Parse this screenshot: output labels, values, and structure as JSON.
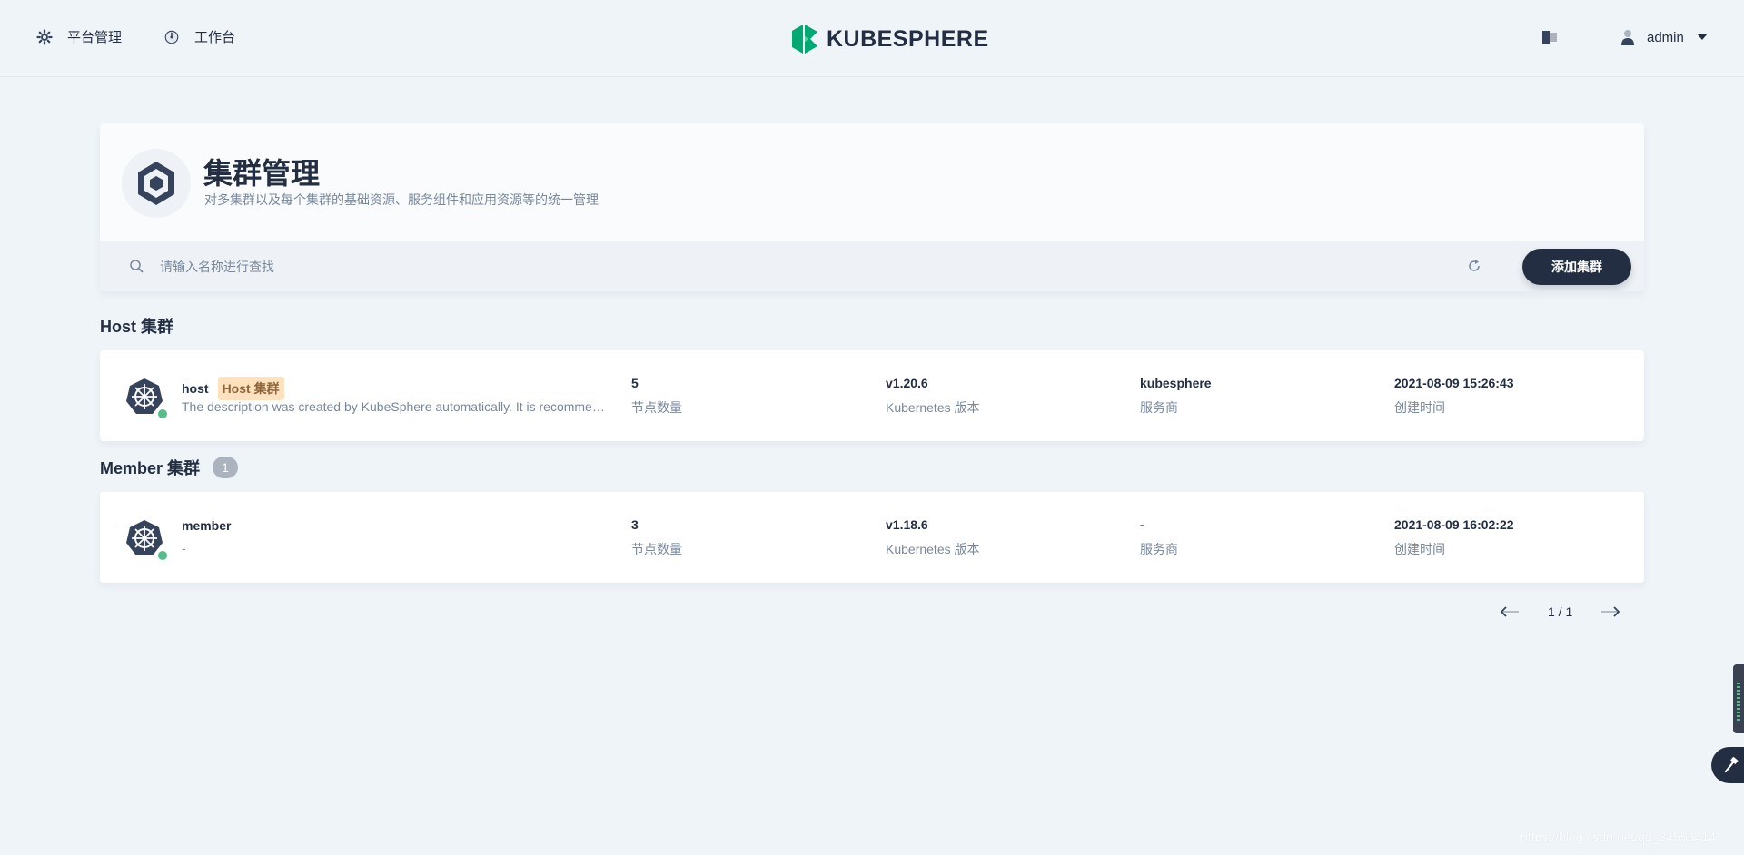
{
  "nav": {
    "platform_label": "平台管理",
    "workbench_label": "工作台",
    "logo_text": "KUBESPHERE",
    "user_name": "admin"
  },
  "banner": {
    "title": "集群管理",
    "description": "对多集群以及每个集群的基础资源、服务组件和应用资源等的统一管理"
  },
  "toolbar": {
    "search_placeholder": "请输入名称进行查找",
    "add_button": "添加集群"
  },
  "host_section": {
    "title": "Host 集群",
    "clusters": [
      {
        "name": "host",
        "tag": "Host 集群",
        "description": "The description was created by KubeSphere automatically. It is recommended that you use the Host Cluster to manage clusters only and deploy workloads on Member Clusters.",
        "nodes": "5",
        "nodes_label": "节点数量",
        "version": "v1.20.6",
        "version_label": "Kubernetes 版本",
        "provider": "kubesphere",
        "provider_label": "服务商",
        "created": "2021-08-09 15:26:43",
        "created_label": "创建时间"
      }
    ]
  },
  "member_section": {
    "title": "Member 集群",
    "count": "1",
    "clusters": [
      {
        "name": "member",
        "description": "-",
        "nodes": "3",
        "nodes_label": "节点数量",
        "version": "v1.18.6",
        "version_label": "Kubernetes 版本",
        "provider": "-",
        "provider_label": "服务商",
        "created": "2021-08-09 16:02:22",
        "created_label": "创建时间"
      }
    ]
  },
  "pagination": {
    "text": "1 / 1"
  },
  "watermark": "https://blog.csdn.net/qq_34556414",
  "colors": {
    "background": "#eff4f9",
    "primary_dark": "#242e42",
    "status_running": "#55bc8a",
    "host_tag_bg": "#ffe1be",
    "logo_green": "#00a971"
  }
}
